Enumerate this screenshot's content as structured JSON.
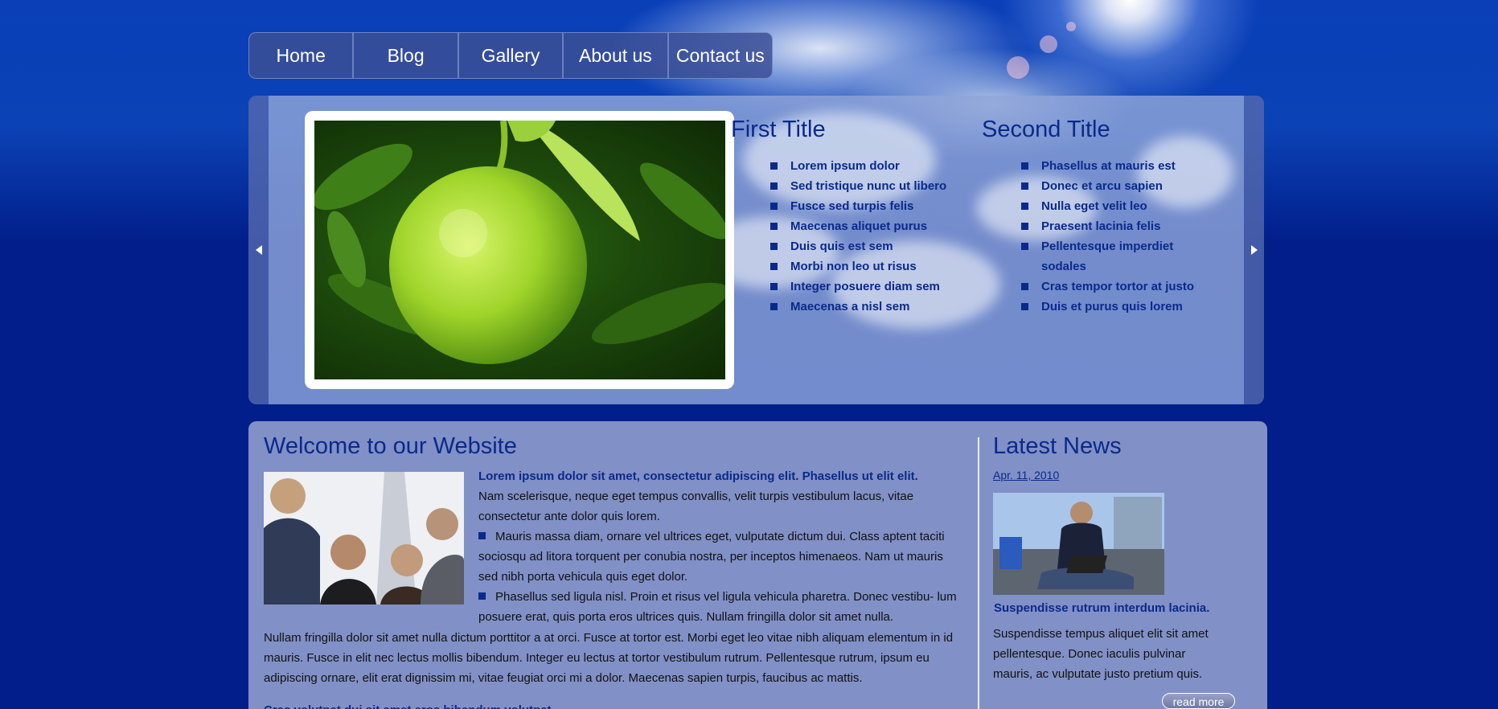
{
  "nav": {
    "items": [
      "Home",
      "Blog",
      "Gallery",
      "About us",
      "Contact us"
    ]
  },
  "slider": {
    "prev_icon": "arrow-left-icon",
    "next_icon": "arrow-right-icon",
    "first": {
      "title": "First Title",
      "items": [
        "Lorem ipsum dolor",
        "Sed tristique nunc ut libero",
        "Fusce sed turpis felis",
        "Maecenas aliquet purus",
        "Duis quis est sem",
        "Morbi non leo ut risus",
        "Integer posuere diam sem",
        "Maecenas a nisl sem"
      ]
    },
    "second": {
      "title": "Second Title",
      "items": [
        "Phasellus at mauris est",
        "Donec et arcu sapien",
        "Nulla eget velit leo",
        "Praesent lacinia felis",
        "Pellentesque imperdiet sodales",
        "Cras tempor tortor at justo",
        "Duis et purus quis lorem"
      ]
    }
  },
  "welcome": {
    "title": "Welcome to our Website",
    "lead": "Lorem ipsum dolor sit amet, consectetur adipiscing elit. Phasellus ut elit elit.",
    "intro": "Nam scelerisque, neque eget tempus convallis, velit turpis vestibulum lacus, vitae consectetur ante dolor quis lorem.",
    "bullet1": "Mauris massa diam, ornare vel ultrices eget, vulputate dictum dui. Class aptent taciti sociosqu ad litora torquent per conubia nostra, per inceptos himenaeos. Nam ut mauris sed nibh porta vehicula quis eget dolor.",
    "bullet2": "Phasellus sed ligula nisl. Proin et risus vel ligula vehicula pharetra. Donec vestibu- lum posuere erat, quis porta eros ultrices quis. Nullam fringilla dolor sit amet nulla.",
    "paragraph": "Nullam fringilla dolor sit amet nulla dictum porttitor a at orci. Fusce at tortor est. Morbi eget leo vitae nibh aliquam elementum in id mauris. Fusce in elit nec lectus mollis bibendum. Integer eu lectus at tortor vestibulum rutrum. Pellentesque rutrum, ipsum eu adipiscing ornare, elit erat dignissim mi, vitae feugiat orci mi a dolor. Maecenas sapien turpis, faucibus ac mattis.",
    "cut_heading": "Cras volutpat dui sit amet eros bibendum volutpat."
  },
  "news": {
    "title": "Latest News",
    "date": "Apr. 11, 2010",
    "headline": "Suspendisse rutrum interdum lacinia.",
    "body": "Suspendisse tempus aliquet elit sit amet pellentesque. Donec iaculis pulvinar mauris, ac vulputate justo pretium quis.",
    "read_more": "read more"
  },
  "colors": {
    "background": "#021e8b",
    "heading": "#0a2a8a",
    "panel": "#8190c6"
  }
}
